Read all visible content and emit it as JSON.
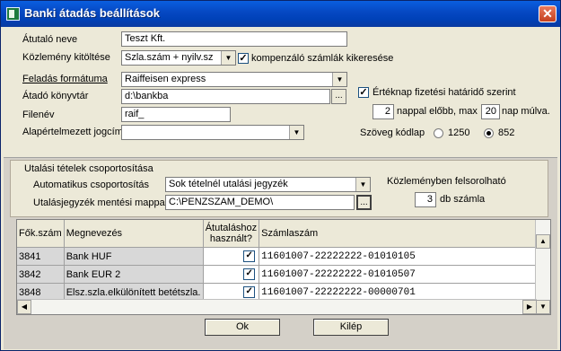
{
  "window": {
    "title": "Banki átadás beállítások",
    "close_glyph": "✕"
  },
  "form": {
    "atutalo_neve": {
      "label": "Átutaló neve",
      "value": "Teszt Kft."
    },
    "kozlemeny_kitoltese": {
      "label": "Közlemény kitöltése",
      "value": "Szla.szám + nyilv.sz",
      "checkbox_label": "kompenzáló számlák kikeresése",
      "checked": true
    },
    "feladas_formatuma": {
      "label": "Feladás formátuma",
      "value": "Raiffeisen express"
    },
    "atado_konyvtar": {
      "label": "Átadó könyvtár",
      "value": "d:\\bankba",
      "browse": "..."
    },
    "filenev": {
      "label": "Filenév",
      "value": "raif_"
    },
    "alapertelmezett_jogcim": {
      "label": "Alapértelmezett jogcím",
      "value": ""
    },
    "ertéknap": {
      "label": "Értéknap fizetési határidő szerint",
      "checked": true
    },
    "napok": {
      "before": "2",
      "before_label": "nappal előbb, max",
      "after": "20",
      "after_label": "nap múlva."
    },
    "kodlap": {
      "label": "Szöveg kódlap",
      "options": [
        "1250",
        "852"
      ],
      "selected": "852"
    }
  },
  "csoportositas": {
    "title": "Utalási tételek csoportosítása",
    "auto_label": "Automatikus csoportosítás",
    "auto_value": "Sok tételnél utalási jegyzék",
    "mentesi_label": "Utalásjegyzék mentési mappa",
    "mentesi_value": "C:\\PENZSZAM_DEMO\\",
    "browse": "...",
    "kozlemeny_title": "Közleményben felsorolható",
    "db_value": "3",
    "db_label": "db számla"
  },
  "table": {
    "headers": [
      "Fők.szám",
      "Megnevezés",
      "Átutaláshoz használt?",
      "Számlaszám"
    ],
    "rows": [
      {
        "fokszam": "3841",
        "megnevezes": "Bank HUF",
        "hasznalt": true,
        "szamlaszam": "11601007-22222222-01010105"
      },
      {
        "fokszam": "3842",
        "megnevezes": "Bank EUR 2",
        "hasznalt": true,
        "szamlaszam": "11601007-22222222-01010507"
      },
      {
        "fokszam": "3848",
        "megnevezes": "Elsz.szla.elkülönített betétszla.",
        "hasznalt": true,
        "szamlaszam": "11601007-22222222-00000701"
      }
    ]
  },
  "buttons": {
    "ok": "Ok",
    "exit": "Kilép"
  },
  "glyphs": {
    "check": "✓",
    "down": "▼",
    "up": "▲",
    "left": "◀",
    "right": "▶"
  }
}
